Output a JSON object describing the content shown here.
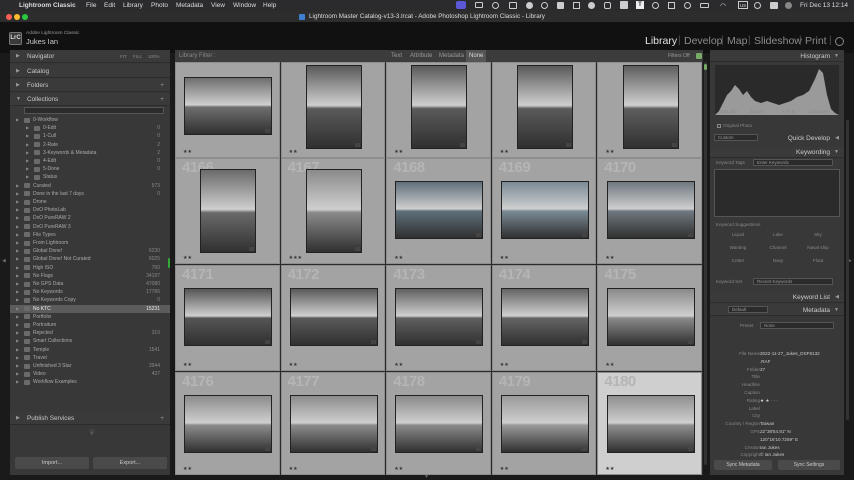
{
  "menubar": {
    "items": [
      "Lightroom Classic",
      "File",
      "Edit",
      "Library",
      "Photo",
      "Metadata",
      "View",
      "Window",
      "Help"
    ],
    "clock": "Fri Dec 13  12:14"
  },
  "window": {
    "title": "Lightroom Master Catalog-v13-3.lrcat - Adobe Photoshop Lightroom Classic - Library"
  },
  "identity": {
    "badge": "LrC",
    "app_line": "Adobe Lightroom Classic",
    "user": "Jukes Ian"
  },
  "modules": [
    "Library",
    "Develop",
    "Map",
    "Slideshow",
    "Print",
    "Web"
  ],
  "active_module": "Library",
  "left_panel": {
    "navigator": "Navigator",
    "nav_zoom": [
      "FIT",
      "FILL",
      "100%"
    ],
    "catalog": "Catalog",
    "folders": "Folders",
    "collections": "Collections",
    "collection_rows": [
      {
        "label": "0-Workflow",
        "count": "",
        "level": 1
      },
      {
        "label": "0-Edit",
        "count": "0",
        "level": 2
      },
      {
        "label": "1-Cull",
        "count": "0",
        "level": 2
      },
      {
        "label": "2-Rate",
        "count": "2",
        "level": 2
      },
      {
        "label": "3-Keywords & Metadata",
        "count": "2",
        "level": 2
      },
      {
        "label": "4-Edit",
        "count": "0",
        "level": 2
      },
      {
        "label": "5-Done",
        "count": "0",
        "level": 2
      },
      {
        "label": "Status",
        "count": "",
        "level": 2
      },
      {
        "label": "Curated",
        "count": "573",
        "level": 1
      },
      {
        "label": "Done in the last 7 days",
        "count": "0",
        "level": 1
      },
      {
        "label": "Drone",
        "count": "",
        "level": 1
      },
      {
        "label": "DxO PhotoLab",
        "count": "",
        "level": 1
      },
      {
        "label": "DxO PureRAW 2",
        "count": "",
        "level": 1
      },
      {
        "label": "DxO PureRAW 3",
        "count": "",
        "level": 1
      },
      {
        "label": "File Types",
        "count": "",
        "level": 1
      },
      {
        "label": "From Lightroom",
        "count": "",
        "level": 1
      },
      {
        "label": "Global Done!",
        "count": "6230",
        "level": 1
      },
      {
        "label": "Global Done! Not Curated",
        "count": "6025",
        "level": 1
      },
      {
        "label": "High ISO",
        "count": "760",
        "level": 1
      },
      {
        "label": "No Flags",
        "count": "34197",
        "level": 1
      },
      {
        "label": "No GPS Data",
        "count": "47080",
        "level": 1
      },
      {
        "label": "No Keywords",
        "count": "17786",
        "level": 1
      },
      {
        "label": "No Keywords Copy",
        "count": "0",
        "level": 1
      },
      {
        "label": "No KTC",
        "count": "15231",
        "level": 1,
        "selected": true
      },
      {
        "label": "Portfolio",
        "count": "",
        "level": 1
      },
      {
        "label": "Portraiture",
        "count": "",
        "level": 1
      },
      {
        "label": "Rejected",
        "count": "310",
        "level": 1
      },
      {
        "label": "Smart Collections",
        "count": "",
        "level": 1
      },
      {
        "label": "Temple",
        "count": "1541",
        "level": 1
      },
      {
        "label": "Travel",
        "count": "",
        "level": 1
      },
      {
        "label": "Unfinished 3 Star",
        "count": "3944",
        "level": 1
      },
      {
        "label": "Video",
        "count": "437",
        "level": 1
      },
      {
        "label": "Workflow Examples",
        "count": "",
        "level": 1
      }
    ],
    "publish_services": "Publish Services",
    "import_label": "Import...",
    "export_label": "Export..."
  },
  "filter_bar": {
    "label": "Library Filter :",
    "options": [
      "Text",
      "Attribute",
      "Metadata",
      "None"
    ],
    "active": "None",
    "filters_state": "Filters Off"
  },
  "grid": {
    "rows": [
      {
        "cells": [
          {
            "num": "",
            "stars": "★★",
            "tone": "#6e6e6e"
          },
          {
            "num": "",
            "stars": "★★",
            "tone": "#5a5a5a"
          },
          {
            "num": "",
            "stars": "★★",
            "tone": "#5a5a5a"
          },
          {
            "num": "",
            "stars": "★★",
            "tone": "#5a5a5a"
          },
          {
            "num": "",
            "stars": "★★",
            "tone": "#5e5e5e"
          }
        ]
      },
      {
        "cells": [
          {
            "num": "4166",
            "stars": "★★",
            "tone": "#6a6a6a"
          },
          {
            "num": "4167",
            "stars": "★★★",
            "tone": "#8a8a8a"
          },
          {
            "num": "4168",
            "stars": "★★",
            "tone": "#5f6f7a"
          },
          {
            "num": "4169",
            "stars": "★★",
            "tone": "#7a8a95"
          },
          {
            "num": "4170",
            "stars": "★★",
            "tone": "#6f7880"
          }
        ]
      },
      {
        "cells": [
          {
            "num": "4171",
            "stars": "★★",
            "tone": "#555555"
          },
          {
            "num": "4172",
            "stars": "★★",
            "tone": "#5a5a5a"
          },
          {
            "num": "4173",
            "stars": "★★",
            "tone": "#606060"
          },
          {
            "num": "4174",
            "stars": "★★",
            "tone": "#646464"
          },
          {
            "num": "4175",
            "stars": "★★",
            "tone": "#8a8a8a"
          }
        ]
      },
      {
        "cells": [
          {
            "num": "4176",
            "stars": "★★",
            "tone": "#8c8c8c"
          },
          {
            "num": "4177",
            "stars": "★★",
            "tone": "#8c8c8c"
          },
          {
            "num": "4178",
            "stars": "★★",
            "tone": "#8a8a8a"
          },
          {
            "num": "4179",
            "stars": "★★",
            "tone": "#9a9a9a"
          },
          {
            "num": "4180",
            "stars": "★★",
            "tone": "#8f8f8f",
            "selected": true
          }
        ]
      }
    ]
  },
  "right_panel": {
    "histogram": "Histogram",
    "hist_readouts": [
      "ISO 100",
      "16 mm",
      "f / 5.6",
      "1/320 sec"
    ],
    "original_photo": "Original Photo",
    "custom_label": "Custom",
    "quick_develop": "Quick Develop",
    "keywording": "Keywording",
    "keyword_tags_label": "Keyword Tags",
    "keyword_tags_value": "Enter Keywords",
    "keyword_suggestions": "Keyword Suggestions",
    "suggestions": [
      "Liquid",
      "Lake",
      "Sky",
      "Wanting",
      "Channel",
      "Naval ship",
      "Cotter",
      "Navy",
      "Float"
    ],
    "keyword_set_label": "Keyword Set",
    "keyword_set_value": "Recent Keywords",
    "keyword_list": "Keyword List",
    "metadata": "Metadata",
    "metadata_preset_mode": "Default",
    "preset_label": "Preset",
    "preset_value": "None",
    "metadata_rows": [
      {
        "k": "File Name",
        "v": "2022-11-27_Jukes_DSF8132"
      },
      {
        "k": "",
        "v": ".RAF"
      },
      {
        "k": "Folder",
        "v": "27"
      },
      {
        "k": "Title",
        "v": ""
      },
      {
        "k": "Headline",
        "v": ""
      },
      {
        "k": "Caption",
        "v": ""
      },
      {
        "k": "Rating",
        "v": "★ ★ · · ·"
      },
      {
        "k": "Label",
        "v": ""
      },
      {
        "k": "City",
        "v": ""
      },
      {
        "k": "Country / Region",
        "v": "Taiwan"
      },
      {
        "k": "GPS",
        "v": "22°38'54.81\" N"
      },
      {
        "k": "",
        "v": "120°16'10.7259\" E"
      },
      {
        "k": "Creator",
        "v": "Ian Jukes"
      },
      {
        "k": "Copyright",
        "v": "© Ian Jukes"
      }
    ],
    "sync_metadata": "Sync Metadata",
    "sync_settings": "Sync Settings"
  }
}
